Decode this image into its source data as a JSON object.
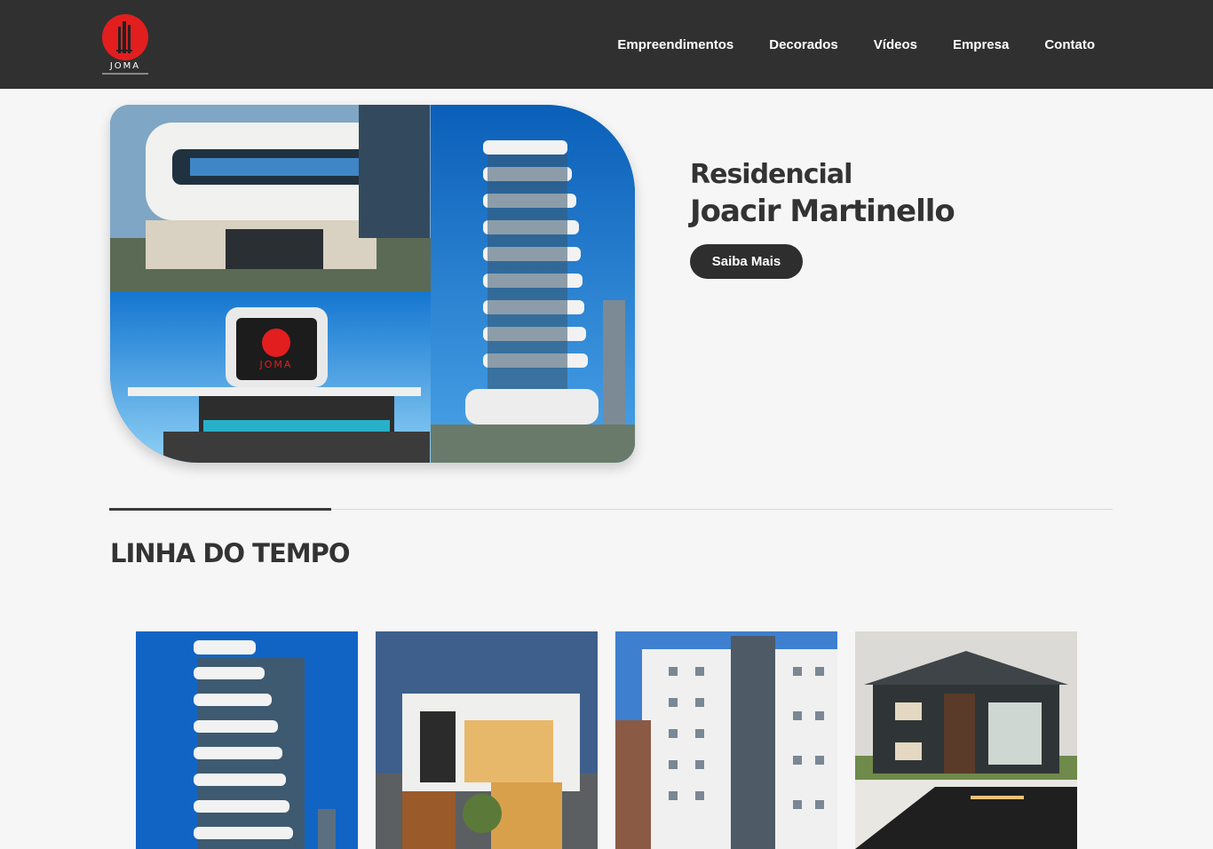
{
  "brand": {
    "name": "JOMA",
    "logo_color": "#e31e1e"
  },
  "nav": {
    "items": [
      "Empreendimentos",
      "Decorados",
      "Vídeos",
      "Empresa",
      "Contato"
    ]
  },
  "hero": {
    "title_line1": "Residencial",
    "title_line2": "Joacir Martinello",
    "cta_label": "Saiba Mais",
    "image_sign_text": "JOMA"
  },
  "timeline": {
    "title": "LINHA DO TEMPO",
    "cards": [
      {
        "subject": "residential-tower-render"
      },
      {
        "subject": "modern-house-night"
      },
      {
        "subject": "apartment-building"
      },
      {
        "subject": "two-story-house"
      }
    ]
  },
  "colors": {
    "header_bg": "#303030",
    "page_bg": "#f6f6f6",
    "button_bg": "#2e2e2e",
    "accent_red": "#e31e1e",
    "sky_blue": "#1c6fc0"
  }
}
